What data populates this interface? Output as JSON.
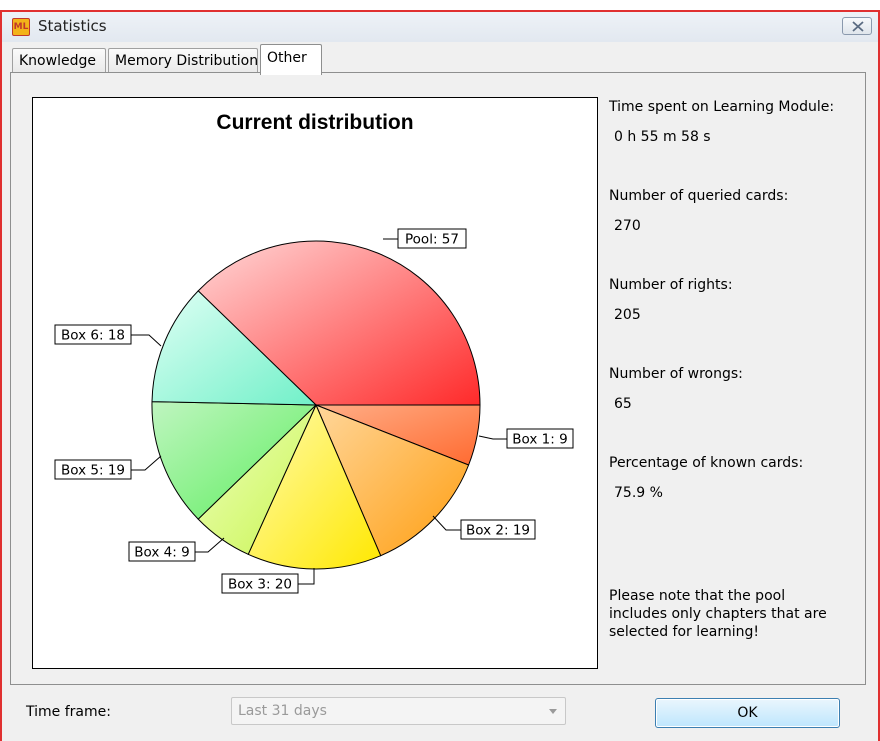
{
  "window": {
    "title": "Statistics",
    "app_icon_text": "ML",
    "accent_color": "#e03030"
  },
  "tabs": [
    {
      "label": "Knowledge",
      "active": false
    },
    {
      "label": "Memory Distribution",
      "active": false
    },
    {
      "label": "Other",
      "active": true
    }
  ],
  "chart_data": {
    "type": "pie",
    "title": "Current distribution",
    "slices": [
      {
        "label": "Pool",
        "value": 57,
        "color_start": "#ffd8d8",
        "color_end": "#ff2a2a"
      },
      {
        "label": "Box 1",
        "value": 9,
        "color_start": "#ffae87",
        "color_end": "#ff6a30"
      },
      {
        "label": "Box 2",
        "value": 19,
        "color_start": "#ffd69a",
        "color_end": "#ff9e10"
      },
      {
        "label": "Box 3",
        "value": 20,
        "color_start": "#fffbb0",
        "color_end": "#ffe800"
      },
      {
        "label": "Box 4",
        "value": 9,
        "color_start": "#efffbe",
        "color_end": "#c8f550"
      },
      {
        "label": "Box 5",
        "value": 19,
        "color_start": "#bff5c0",
        "color_end": "#5dee5d"
      },
      {
        "label": "Box 6",
        "value": 18,
        "color_start": "#e0fff5",
        "color_end": "#70f0c8"
      }
    ]
  },
  "stats": {
    "time_spent_label": "Time spent on Learning Module:",
    "time_spent_value": "0 h 55 m 58 s",
    "queried_label": "Number of queried cards:",
    "queried_value": "270",
    "rights_label": "Number of rights:",
    "rights_value": "205",
    "wrongs_label": "Number of wrongs:",
    "wrongs_value": "65",
    "known_pct_label": "Percentage of known cards:",
    "known_pct_value": "75.9 %",
    "note": "Please note that the pool includes only chapters that are selected for learning!"
  },
  "footer": {
    "timeframe_label": "Time frame:",
    "timeframe_value": "Last 31 days",
    "ok_label": "OK"
  }
}
